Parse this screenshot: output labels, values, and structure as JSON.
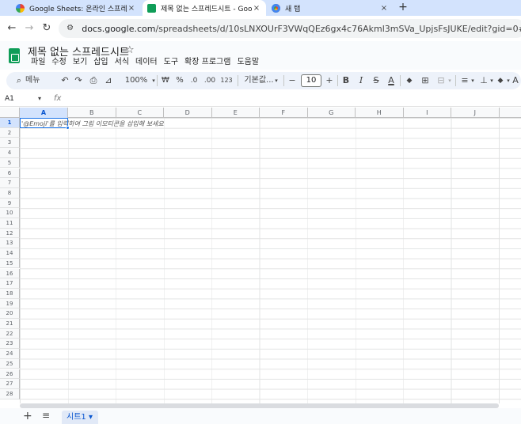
{
  "browser": {
    "tabs": [
      {
        "title": "Google Sheets: 온라인 스프레",
        "close": "×"
      },
      {
        "title": "제목 없는 스프레드시트 - Goo",
        "close": "×"
      },
      {
        "title": "새 탭",
        "close": "×"
      }
    ],
    "new_tab": "+",
    "url_host": "docs.google.com",
    "url_path": "/spreadsheets/d/10sLNXOUrF3VWqQEz6gx4c76Akml3mSVa_UpjsFsJUKE/edit?gid=0#gid=0"
  },
  "doc": {
    "title": "제목 없는 스프레드시트",
    "star": "☆",
    "menus": [
      "파일",
      "수정",
      "보기",
      "삽입",
      "서식",
      "데이터",
      "도구",
      "확장 프로그램",
      "도움말"
    ]
  },
  "toolbar": {
    "search_label": "메뉴",
    "undo": "↶",
    "redo": "↷",
    "print": "⎙",
    "paint_format": "⊿",
    "zoom": "100%",
    "currency": "₩",
    "percent": "%",
    "decrease_decimal": ".0",
    "increase_decimal": ".00",
    "number_format": "123",
    "font": "기본값...",
    "font_size_minus": "−",
    "font_size": "10",
    "font_size_plus": "+",
    "bold": "B",
    "italic": "I",
    "strike": "S",
    "text_color": "A",
    "fill_color": "◆",
    "borders": "⊞",
    "merge": "⊟",
    "align": "≡",
    "valign": "⊥",
    "rotate": "◆",
    "more": "A"
  },
  "formula_bar": {
    "name_box": "A1",
    "fx": "fx"
  },
  "grid": {
    "columns": [
      "A",
      "B",
      "C",
      "D",
      "E",
      "F",
      "G",
      "H",
      "I",
      "J"
    ],
    "rows": [
      "1",
      "2",
      "3",
      "4",
      "5",
      "6",
      "7",
      "8",
      "9",
      "10",
      "11",
      "12",
      "13",
      "14",
      "15",
      "16",
      "17",
      "18",
      "19",
      "20",
      "21",
      "22",
      "23",
      "24",
      "25",
      "26",
      "27",
      "28"
    ],
    "a1_placeholder": "'@Emoji'를 입력하여 그림 이모티콘을 삽입해 보세요"
  },
  "sheets": {
    "add": "+",
    "all": "≡",
    "active_sheet": "시트1 ▾"
  },
  "colors": {
    "tab_strip": "#d3e3fd",
    "sheets_green": "#0f9d58",
    "selection_blue": "#1a73e8"
  }
}
